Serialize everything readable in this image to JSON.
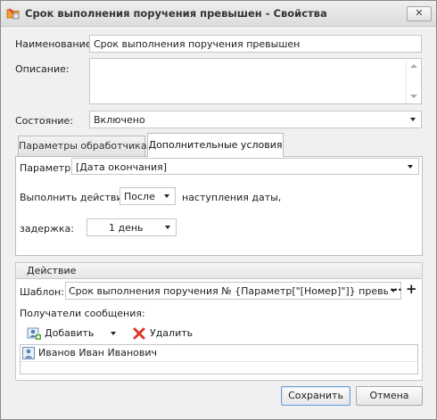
{
  "window": {
    "title": "Срок выполнения поручения превышен - Свойства",
    "close_glyph": "✕"
  },
  "form": {
    "name_label": "Наименование:",
    "name_value": "Срок выполнения поручения превышен",
    "description_label": "Описание:",
    "description_value": "",
    "state_label": "Состояние:",
    "state_value": "Включено"
  },
  "tabs": [
    {
      "label": "Параметры обработчика",
      "active": false
    },
    {
      "label": "Дополнительные условия",
      "active": true
    }
  ],
  "conditions": {
    "param_label": "Параметр:",
    "param_value": "[Дата окончания]",
    "action_prefix": "Выполнить действие",
    "when_value": "После",
    "action_suffix": "наступления даты,",
    "delay_label": "задержка:",
    "delay_value": "1 день"
  },
  "action_group": {
    "title": "Действие",
    "template_label": "Шаблон:",
    "template_value": "Срок выполнения поручения №  {Параметр[\"[Номер]\"]} превышен",
    "ellipsis_glyph": "···",
    "plus_glyph": "+",
    "recipients_label": "Получатели сообщения:",
    "add_label": "Добавить",
    "delete_label": "Удалить",
    "recipients": [
      "Иванов Иван Иванович"
    ]
  },
  "buttons": {
    "save": "Сохранить",
    "cancel": "Отмена"
  },
  "colors": {
    "accent": "#6f9fd4",
    "delete_icon": "#d63b2a",
    "folder_icon": "#f2a03d"
  }
}
